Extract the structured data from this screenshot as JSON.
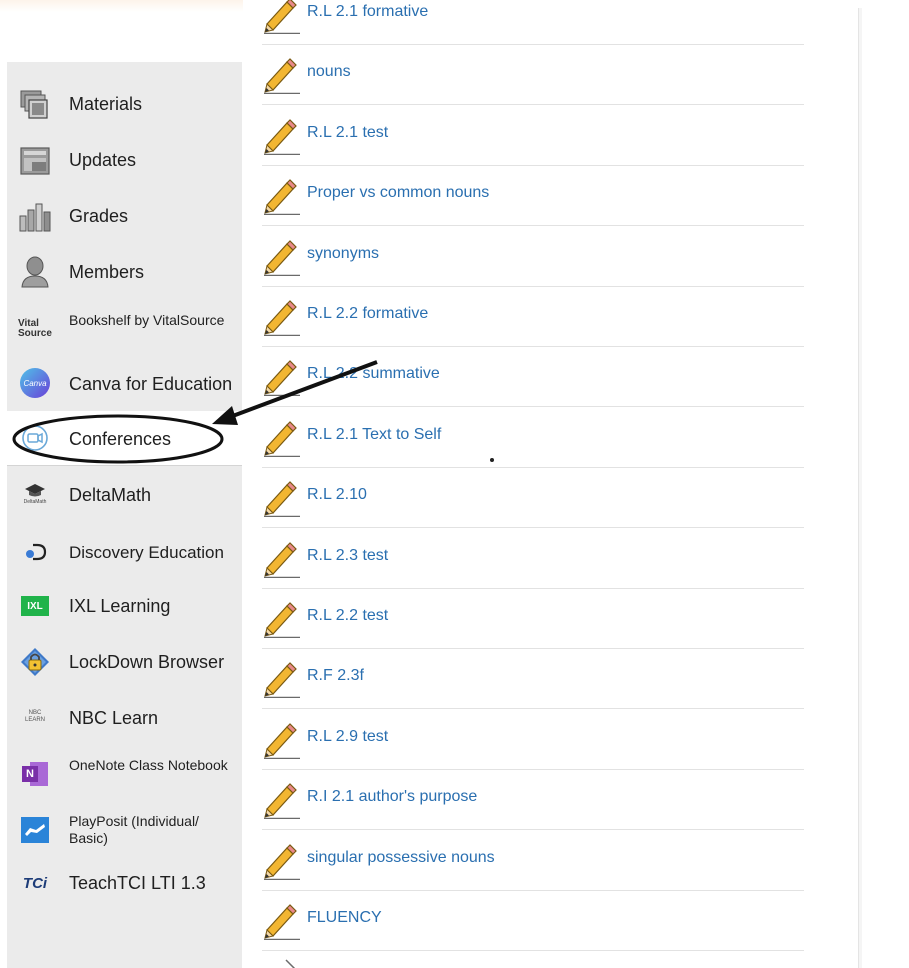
{
  "sidebar": {
    "items": [
      {
        "label": "Materials",
        "icon": "materials-icon"
      },
      {
        "label": "Updates",
        "icon": "updates-icon"
      },
      {
        "label": "Grades",
        "icon": "grades-icon"
      },
      {
        "label": "Members",
        "icon": "members-icon"
      },
      {
        "label": "Bookshelf by VitalSource",
        "icon": "vitalsource-icon",
        "icon_text": "Vital Source"
      },
      {
        "label": "Canva for Education",
        "icon": "canva-icon",
        "icon_text": "Canva"
      },
      {
        "label": "Conferences",
        "icon": "conferences-icon"
      },
      {
        "label": "DeltaMath",
        "icon": "deltamath-icon",
        "icon_text": "DeltaMath"
      },
      {
        "label": "Discovery Education",
        "icon": "discovery-education-icon"
      },
      {
        "label": "IXL Learning",
        "icon": "ixl-icon",
        "icon_text": "IXL"
      },
      {
        "label": "LockDown Browser",
        "icon": "lockdown-browser-icon"
      },
      {
        "label": "NBC Learn",
        "icon": "nbc-learn-icon",
        "icon_text": "NBC LEARN"
      },
      {
        "label": "OneNote Class Notebook",
        "icon": "onenote-icon",
        "icon_text": "N"
      },
      {
        "label": "PlayPosit (Individual/ Basic)",
        "icon": "playposit-icon"
      },
      {
        "label": "TeachTCI LTI 1.3",
        "icon": "teachtci-icon",
        "icon_text": "TCi"
      }
    ]
  },
  "materials": {
    "items": [
      "R.L 2.1 formative",
      "nouns",
      "R.L 2.1 test",
      "Proper vs common nouns",
      "synonyms",
      "R.L 2.2 formative",
      "R.L 2.2 summative",
      "R.L 2.1 Text to Self",
      "R.L 2.10",
      "R.L 2.3 test",
      "R.L 2.2 test",
      "R.F 2.3f",
      "R.L 2.9 test",
      "R.I 2.1 author's purpose",
      "singular possessive nouns",
      "FLUENCY"
    ]
  },
  "colors": {
    "link": "#2a6fb0",
    "sidebar_bg": "#ebebeb",
    "pencil_yellow": "#f2b632",
    "annotation": "#111111"
  }
}
